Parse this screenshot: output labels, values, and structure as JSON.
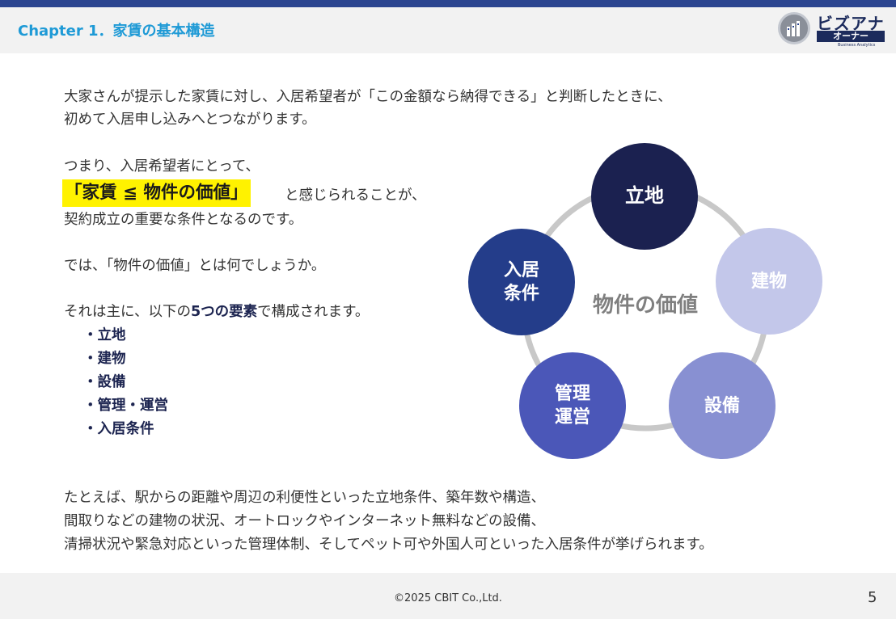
{
  "header": {
    "chapter_title": "Chapter 1．家賃の基本構造",
    "logo_main": "ビズアナ",
    "logo_sub": "オーナー",
    "logo_tiny": "Business Analytics"
  },
  "body": {
    "intro_line1": "大家さんが提示した家賃に対し、入居希望者が「この金額なら納得できる」と判断したときに、",
    "intro_line2": "初めて入居申し込みへとつながります。",
    "para2_line1": "つまり、入居希望者にとって、",
    "highlight": "「家賃 ≦ 物件の価値」",
    "para2_line2_rest": "と感じられることが、",
    "para2_line3": "契約成立の重要な条件となるのです。",
    "question": "では、「物件の価値」とは何でしょうか。",
    "elements_intro_prefix": "それは主に、以下の",
    "elements_intro_bold": "5つの要素",
    "elements_intro_suffix": "で構成されます。",
    "bullets": [
      "・立地",
      "・建物",
      "・設備",
      "・管理・運営",
      "・入居条件"
    ],
    "example_line1": "たとえば、駅からの距離や周辺の利便性といった立地条件、築年数や構造、",
    "example_line2": "間取りなどの建物の状況、オートロックやインターネット無料などの設備、",
    "example_line3": "清掃状況や緊急対応といった管理体制、そしてペット可や外国人可といった入居条件が挙げられます。"
  },
  "diagram": {
    "center_label": "物件の価値",
    "nodes": [
      {
        "lines": [
          "立地"
        ],
        "color": "#1b2150"
      },
      {
        "lines": [
          "建物"
        ],
        "color": "#c3c7ea"
      },
      {
        "lines": [
          "設備"
        ],
        "color": "#8890d2"
      },
      {
        "lines": [
          "管理",
          "運営"
        ],
        "color": "#4b57b8"
      },
      {
        "lines": [
          "入居",
          "条件"
        ],
        "color": "#243d8a"
      }
    ],
    "ring_color": "#c8c8c8"
  },
  "footer": {
    "copyright": "©2025 CBIT Co.,Ltd.",
    "page_number": "5"
  }
}
